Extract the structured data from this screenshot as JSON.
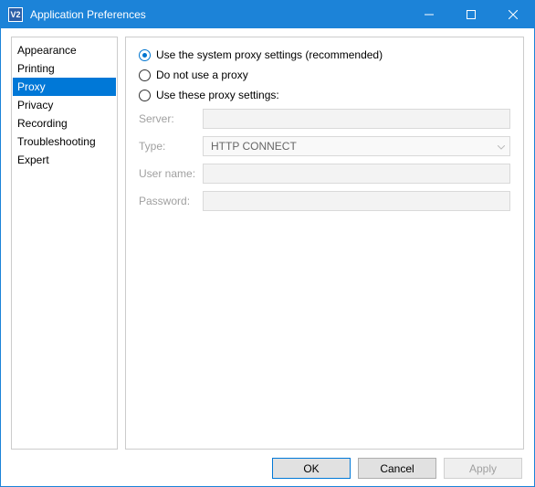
{
  "window": {
    "title": "Application Preferences"
  },
  "sidebar": {
    "items": [
      {
        "label": "Appearance"
      },
      {
        "label": "Printing"
      },
      {
        "label": "Proxy"
      },
      {
        "label": "Privacy"
      },
      {
        "label": "Recording"
      },
      {
        "label": "Troubleshooting"
      },
      {
        "label": "Expert"
      }
    ],
    "selected_index": 2
  },
  "proxy": {
    "options": {
      "system": "Use the system proxy settings (recommended)",
      "none": "Do not use a proxy",
      "custom": "Use these proxy settings:"
    },
    "selected": "system",
    "labels": {
      "server": "Server:",
      "type": "Type:",
      "username": "User name:",
      "password": "Password:"
    },
    "fields": {
      "server": "",
      "type": "HTTP CONNECT",
      "username": "",
      "password": ""
    }
  },
  "buttons": {
    "ok": "OK",
    "cancel": "Cancel",
    "apply": "Apply"
  }
}
